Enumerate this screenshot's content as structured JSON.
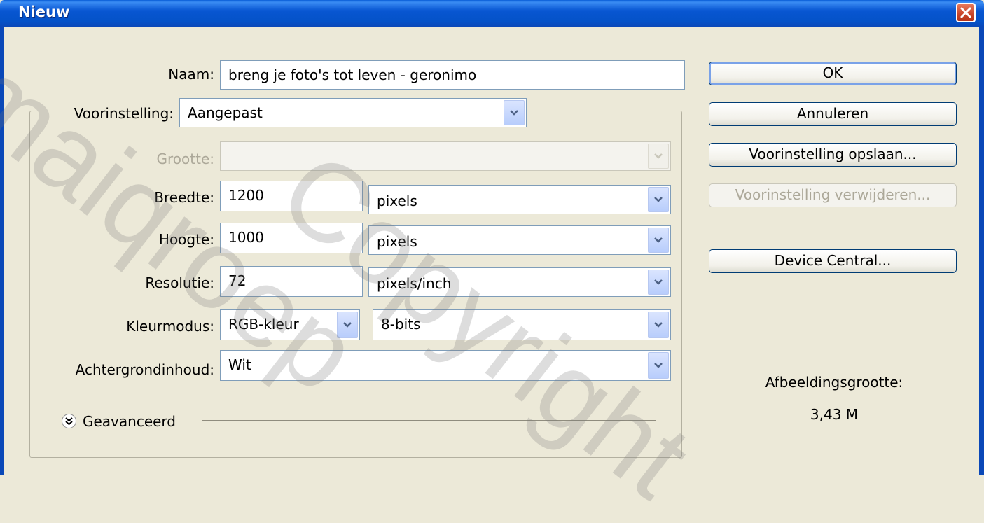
{
  "window": {
    "title": "Nieuw",
    "close_icon": "close-icon"
  },
  "form": {
    "naam": {
      "label": "Naam:",
      "value": "breng je foto's tot leven - geronimo"
    },
    "voorinstelling": {
      "label": "Voorinstelling:",
      "value": "Aangepast"
    },
    "grootte": {
      "label": "Grootte:",
      "value": ""
    },
    "breedte": {
      "label": "Breedte:",
      "value": "1200",
      "unit": "pixels"
    },
    "hoogte": {
      "label": "Hoogte:",
      "value": "1000",
      "unit": "pixels"
    },
    "resolutie": {
      "label": "Resolutie:",
      "value": "72",
      "unit": "pixels/inch"
    },
    "kleurmodus": {
      "label": "Kleurmodus:",
      "value": "RGB-kleur",
      "bits": "8-bits"
    },
    "achtergrond": {
      "label": "Achtergrondinhoud:",
      "value": "Wit"
    },
    "advanced": {
      "label": "Geavanceerd"
    }
  },
  "buttons": {
    "ok": "OK",
    "cancel": "Annuleren",
    "save_preset": "Voorinstelling opslaan...",
    "delete_preset": "Voorinstelling verwijderen...",
    "device_central": "Device Central..."
  },
  "image_size": {
    "label": "Afbeeldingsgrootte:",
    "value": "3,43 M"
  },
  "watermark": {
    "text1": "maiqroep",
    "text2": "Copyright"
  },
  "colors": {
    "titlebar": "#0856d2",
    "dialog_bg": "#ece9d8",
    "field_border": "#7f9db9"
  }
}
